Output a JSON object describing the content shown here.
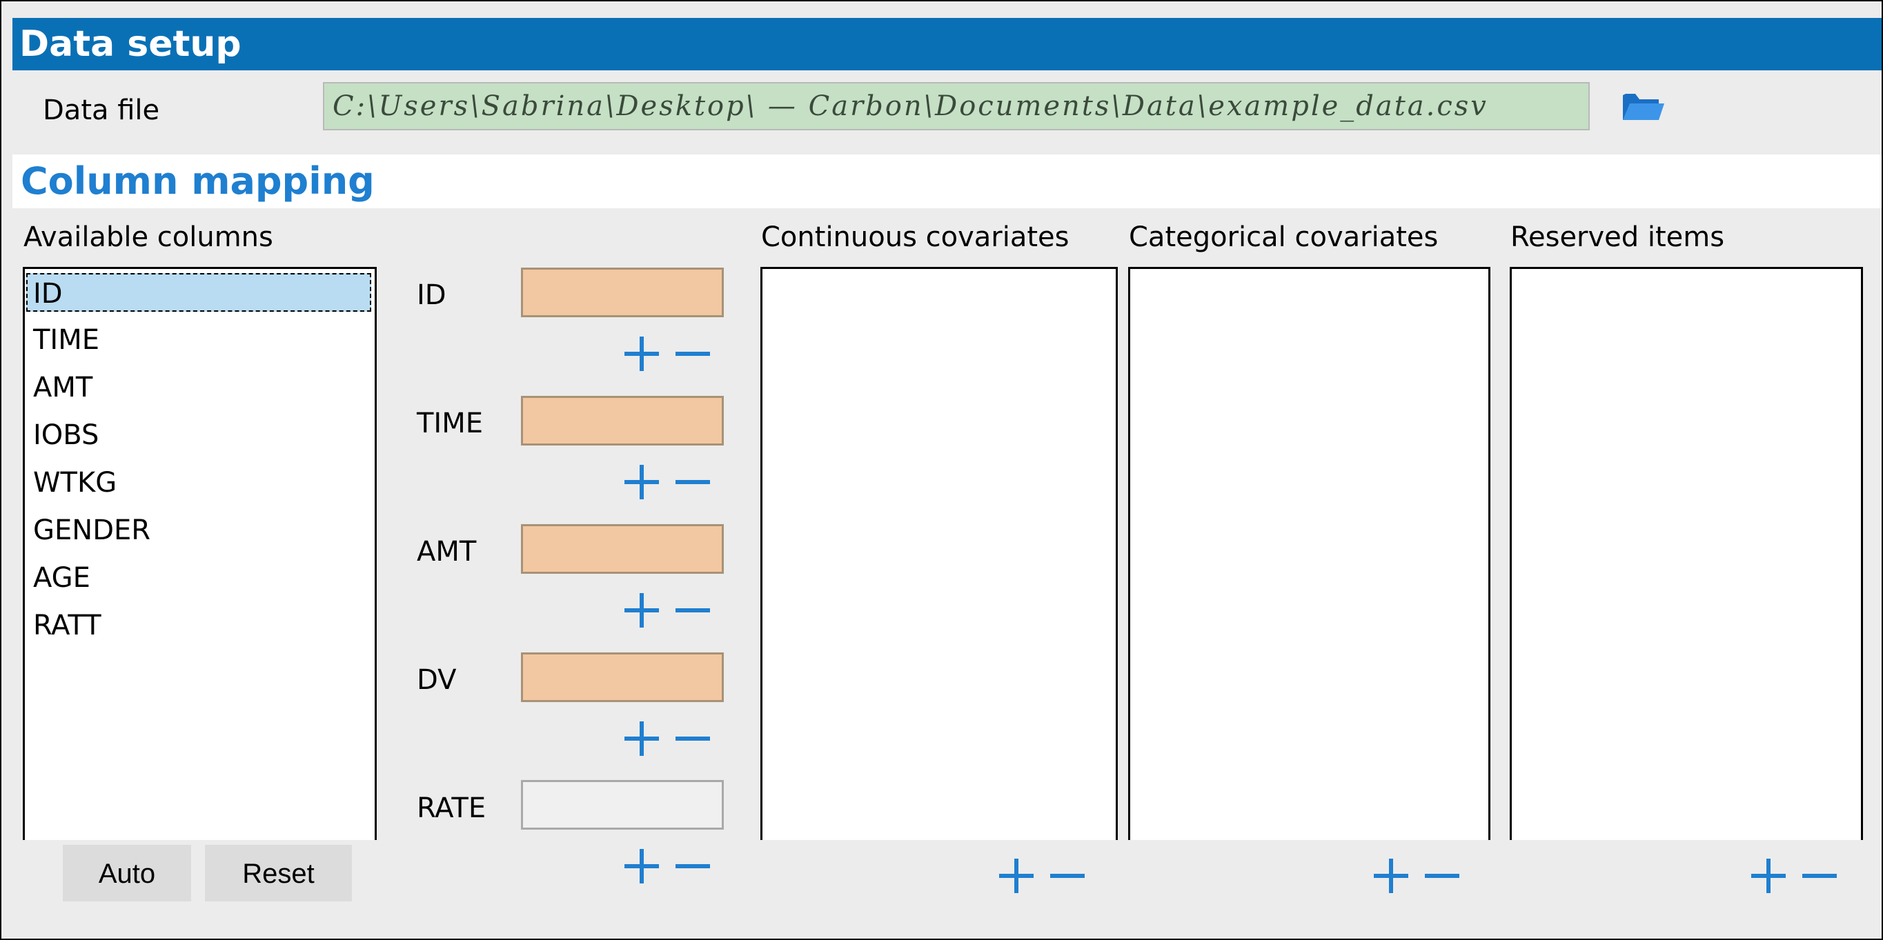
{
  "title": "Data setup",
  "data_file": {
    "label": "Data file",
    "value": "C:\\Users\\Sabrina\\Desktop\\ — Carbon\\Documents\\Data\\example_data.csv"
  },
  "column_mapping": {
    "title": "Column mapping",
    "available_columns": {
      "header": "Available columns",
      "items": [
        "ID",
        "TIME",
        "AMT",
        "IOBS",
        "WTKG",
        "GENDER",
        "AGE",
        "RATT"
      ],
      "selected": "ID"
    },
    "mappings": [
      {
        "label": "ID",
        "value": "",
        "filled": true
      },
      {
        "label": "TIME",
        "value": "",
        "filled": true
      },
      {
        "label": "AMT",
        "value": "",
        "filled": true
      },
      {
        "label": "DV",
        "value": "",
        "filled": true
      },
      {
        "label": "RATE",
        "value": "",
        "filled": false
      }
    ],
    "continuous_covariates": {
      "header": "Continuous covariates",
      "items": []
    },
    "categorical_covariates": {
      "header": "Categorical covariates",
      "items": []
    },
    "reserved_items": {
      "header": "Reserved items",
      "items": []
    }
  },
  "buttons": {
    "auto": "Auto",
    "reset": "Reset"
  },
  "icons": {
    "add": "plus-icon",
    "remove": "minus-icon",
    "browse": "folder-open-icon"
  },
  "colors": {
    "title_bar": "#0a70b5",
    "accent": "#1f7fd0",
    "required_field": "#f2c8a2",
    "data_file_bg": "#c5e0c5",
    "selection": "#b9dcf2"
  }
}
